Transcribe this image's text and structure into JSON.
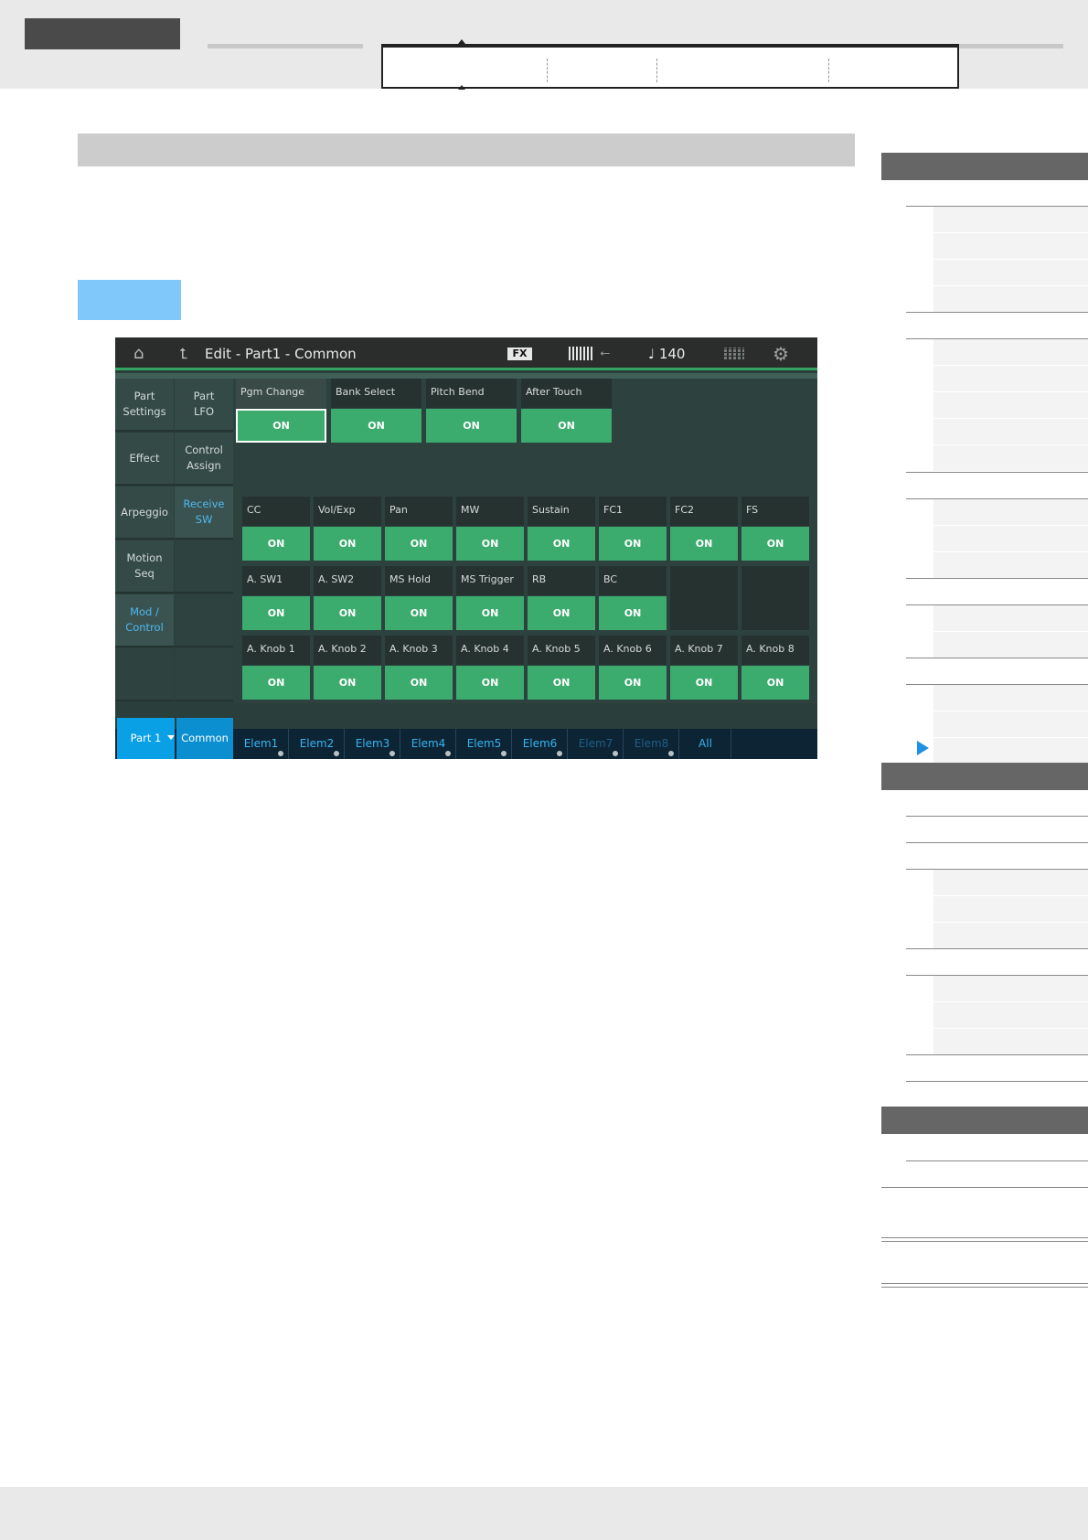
{
  "screen": {
    "header": {
      "title": "Edit - Part1 - Common",
      "fx_badge": "FX",
      "tempo": "♩ 140"
    },
    "nav_primary": [
      {
        "label": "Part Settings",
        "active": false
      },
      {
        "label": "Effect",
        "active": false
      },
      {
        "label": "Arpeggio",
        "active": false
      },
      {
        "label": "Motion Seq",
        "active": false
      },
      {
        "label": "Mod / Control",
        "active": true
      }
    ],
    "nav_secondary": [
      {
        "label": "Part LFO",
        "active": false
      },
      {
        "label": "Control Assign",
        "active": false
      },
      {
        "label": "Receive SW",
        "active": true
      }
    ],
    "receive_top": [
      {
        "label": "Pgm Change",
        "value": "ON",
        "selected": true
      },
      {
        "label": "Bank Select",
        "value": "ON"
      },
      {
        "label": "Pitch Bend",
        "value": "ON"
      },
      {
        "label": "After Touch",
        "value": "ON"
      }
    ],
    "receive_grid": [
      [
        {
          "label": "CC",
          "value": "ON"
        },
        {
          "label": "Vol/Exp",
          "value": "ON"
        },
        {
          "label": "Pan",
          "value": "ON"
        },
        {
          "label": "MW",
          "value": "ON"
        },
        {
          "label": "Sustain",
          "value": "ON"
        },
        {
          "label": "FC1",
          "value": "ON"
        },
        {
          "label": "FC2",
          "value": "ON"
        },
        {
          "label": "FS",
          "value": "ON"
        }
      ],
      [
        {
          "label": "A. SW1",
          "value": "ON"
        },
        {
          "label": "A. SW2",
          "value": "ON"
        },
        {
          "label": "MS Hold",
          "value": "ON"
        },
        {
          "label": "MS Trigger",
          "value": "ON"
        },
        {
          "label": "RB",
          "value": "ON"
        },
        {
          "label": "BC",
          "value": "ON"
        }
      ],
      [
        {
          "label": "A. Knob 1",
          "value": "ON"
        },
        {
          "label": "A. Knob 2",
          "value": "ON"
        },
        {
          "label": "A. Knob 3",
          "value": "ON"
        },
        {
          "label": "A. Knob 4",
          "value": "ON"
        },
        {
          "label": "A. Knob 5",
          "value": "ON"
        },
        {
          "label": "A. Knob 6",
          "value": "ON"
        },
        {
          "label": "A. Knob 7",
          "value": "ON"
        },
        {
          "label": "A. Knob 8",
          "value": "ON"
        }
      ]
    ],
    "bottom": {
      "part_label": "Part 1",
      "common_label": "Common",
      "elements": [
        {
          "label": "Elem1",
          "enabled": true
        },
        {
          "label": "Elem2",
          "enabled": true
        },
        {
          "label": "Elem3",
          "enabled": true
        },
        {
          "label": "Elem4",
          "enabled": true
        },
        {
          "label": "Elem5",
          "enabled": true
        },
        {
          "label": "Elem6",
          "enabled": true
        },
        {
          "label": "Elem7",
          "enabled": false
        },
        {
          "label": "Elem8",
          "enabled": false
        }
      ],
      "all_label": "All"
    }
  },
  "colors": {
    "on_green": "#3bab6e",
    "accent_blue": "#0aa0e6",
    "active_text": "#4fb8f0",
    "sidebar_pointer": "#1e90e6"
  }
}
